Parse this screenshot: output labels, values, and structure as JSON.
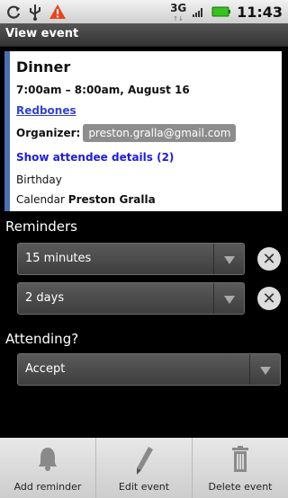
{
  "status_bar": {
    "network_type": "3G",
    "time": "11:43",
    "icons": [
      "sync-icon",
      "usb-icon",
      "warning-icon",
      "signal-icon",
      "battery-icon"
    ]
  },
  "title_bar": {
    "title": "View event"
  },
  "event": {
    "title": "Dinner",
    "time": "7:00am – 8:00am, August 16",
    "location": "Redbones",
    "organizer_label": "Organizer:",
    "organizer_email": "preston.gralla@gmail.com",
    "attendees_link": "Show attendee details (2)",
    "description": "Birthday",
    "calendar_label": "Calendar",
    "calendar_name": "Preston Gralla"
  },
  "reminders": {
    "label": "Reminders",
    "items": [
      {
        "value": "15 minutes"
      },
      {
        "value": "2 days"
      }
    ]
  },
  "attending": {
    "label": "Attending?",
    "value": "Accept"
  },
  "toolbar": {
    "add_reminder": "Add reminder",
    "edit_event": "Edit event",
    "delete_event": "Delete event"
  },
  "colors": {
    "accent": "#4a6fb5",
    "link": "#3344cc",
    "attendee_link": "#1d1de0",
    "warning": "#e8451c",
    "battery": "#36c21f"
  }
}
